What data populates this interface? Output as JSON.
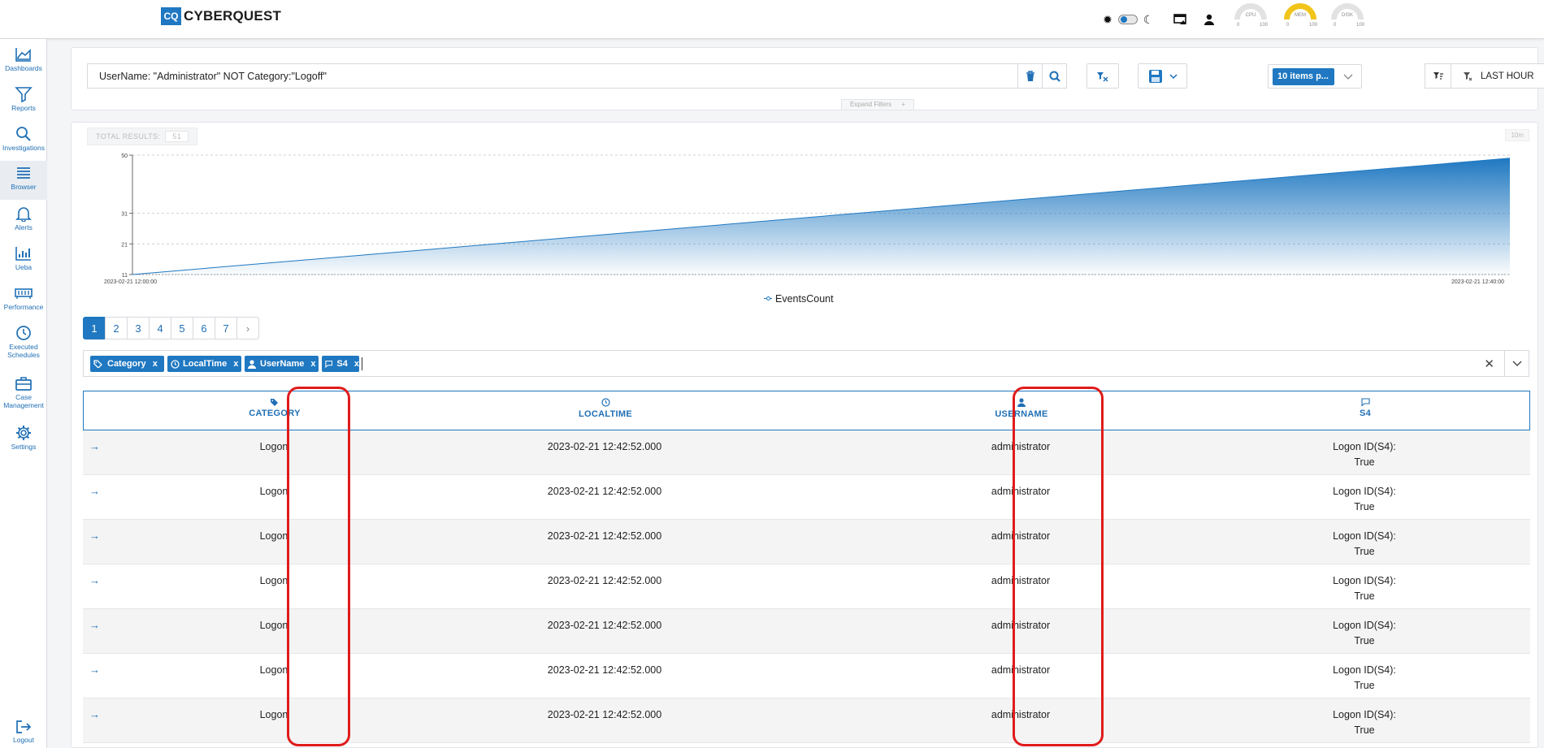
{
  "app": {
    "logo_mark": "CQ",
    "logo_text": "CYBERQUEST",
    "gauges": [
      {
        "label": "CPU",
        "min": "0",
        "max": "100",
        "value": 5
      },
      {
        "label": "MEM",
        "min": "0",
        "max": "100",
        "value": 60
      },
      {
        "label": "DISK",
        "min": "0",
        "max": "100",
        "value": 3
      }
    ],
    "theme_icons": [
      "sun-icon",
      "toggle",
      "moon-icon"
    ],
    "header_icons": [
      "monitor-alert-icon",
      "user-icon"
    ]
  },
  "sidebar": {
    "items": [
      {
        "label": "Dashboards",
        "icon": "dashboard-chart-icon"
      },
      {
        "label": "Reports",
        "icon": "filter-icon"
      },
      {
        "label": "Investigations",
        "icon": "search-icon"
      },
      {
        "label": "Browser",
        "icon": "list-icon",
        "active": true
      },
      {
        "label": "Alerts",
        "icon": "bell-icon"
      },
      {
        "label": "Ueba",
        "icon": "bar-chart-icon"
      },
      {
        "label": "Performance",
        "icon": "memory-icon"
      },
      {
        "label": "Executed Schedules",
        "icon": "clock-icon"
      },
      {
        "label": "Case Management",
        "icon": "briefcase-icon"
      },
      {
        "label": "Settings",
        "icon": "gear-icon"
      }
    ],
    "logout_label": "Logout"
  },
  "search": {
    "query": "UserName: \"Administrator\" NOT Category:\"Logoff\"",
    "items_per_page": "10 items p...",
    "time_range": "LAST HOUR",
    "expand_filters": "Expand Filters"
  },
  "results": {
    "total_label": "TOTAL RESULTS:",
    "total_value": "51",
    "interval": "10m"
  },
  "chart_data": {
    "type": "area",
    "series": [
      {
        "name": "EventsCount",
        "x": [
          "2023-02-21 12:00:00",
          "2023-02-21 12:40:00"
        ],
        "values": [
          11,
          49
        ]
      }
    ],
    "x_tick_labels": [
      "2023-02-21 12:00:00",
      "2023-02-21 12:40:00"
    ],
    "y_tick_labels": [
      "50",
      "31",
      "21",
      "11"
    ],
    "ylim": [
      11,
      50
    ],
    "grid": true,
    "legend": "bottom-center",
    "color": "#1f78c1"
  },
  "pagination": {
    "pages": [
      "1",
      "2",
      "3",
      "4",
      "5",
      "6",
      "7"
    ],
    "current": "1",
    "next": "›"
  },
  "column_chips": [
    {
      "label": "Category",
      "icon": "tags-icon"
    },
    {
      "label": "LocalTime",
      "icon": "clock-icon"
    },
    {
      "label": "UserName",
      "icon": "user-icon"
    },
    {
      "label": "S4",
      "icon": "comment-icon"
    }
  ],
  "table": {
    "columns": [
      {
        "label": "CATEGORY",
        "icon": "tags-icon"
      },
      {
        "label": "LOCALTIME",
        "icon": "clock-icon"
      },
      {
        "label": "USERNAME",
        "icon": "user-icon"
      },
      {
        "label": "S4",
        "icon": "comment-icon"
      }
    ],
    "rows": [
      {
        "category": "Logon",
        "localtime": "2023-02-21 12:42:52.000",
        "username": "administrator",
        "s4_line1": "Logon ID(S4):",
        "s4_line2": "True"
      },
      {
        "category": "Logon",
        "localtime": "2023-02-21 12:42:52.000",
        "username": "administrator",
        "s4_line1": "Logon ID(S4):",
        "s4_line2": "True"
      },
      {
        "category": "Logon",
        "localtime": "2023-02-21 12:42:52.000",
        "username": "administrator",
        "s4_line1": "Logon ID(S4):",
        "s4_line2": "True"
      },
      {
        "category": "Logon",
        "localtime": "2023-02-21 12:42:52.000",
        "username": "administrator",
        "s4_line1": "Logon ID(S4):",
        "s4_line2": "True"
      },
      {
        "category": "Logon",
        "localtime": "2023-02-21 12:42:52.000",
        "username": "administrator",
        "s4_line1": "Logon ID(S4):",
        "s4_line2": "True"
      },
      {
        "category": "Logon",
        "localtime": "2023-02-21 12:42:52.000",
        "username": "administrator",
        "s4_line1": "Logon ID(S4):",
        "s4_line2": "True"
      },
      {
        "category": "Logon",
        "localtime": "2023-02-21 12:42:52.000",
        "username": "administrator",
        "s4_line1": "Logon ID(S4):",
        "s4_line2": "True"
      }
    ]
  },
  "annotation_color": "#e01b1b"
}
